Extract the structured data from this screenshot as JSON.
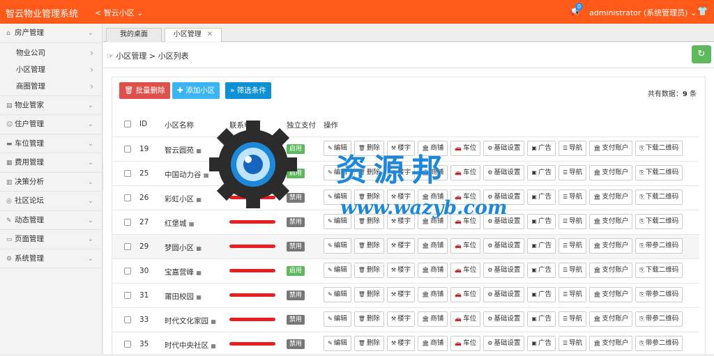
{
  "header": {
    "app_title": "智云物业管理系统",
    "community_selector": "智云小区",
    "notification_count": "0",
    "user": "administrator (系统管理员)"
  },
  "sidebar": {
    "items": [
      {
        "label": "房产管理",
        "icon": "home-icon"
      },
      {
        "label": "物业管家",
        "icon": "doc-icon"
      },
      {
        "label": "住户管理",
        "icon": "user-icon"
      },
      {
        "label": "车位管理",
        "icon": "car-icon"
      },
      {
        "label": "费用管理",
        "icon": "money-icon"
      },
      {
        "label": "决策分析",
        "icon": "chart-icon"
      },
      {
        "label": "社区论坛",
        "icon": "forum-icon"
      },
      {
        "label": "动态管理",
        "icon": "edit-icon"
      },
      {
        "label": "页面管理",
        "icon": "page-icon"
      },
      {
        "label": "系统管理",
        "icon": "gear-icon"
      }
    ],
    "subitems": [
      "物业公司",
      "小区管理",
      "商圈管理"
    ]
  },
  "tabs": [
    {
      "label": "我的桌面"
    },
    {
      "label": "小区管理"
    }
  ],
  "breadcrumb": {
    "root": "小区管理",
    "separator": ">",
    "current": "小区列表"
  },
  "toolbar": {
    "batch_delete": "批量删除",
    "add_community": "添加小区",
    "filter": "筛选条件",
    "total_prefix": "共有数据：",
    "total_count": "9",
    "total_suffix": " 条"
  },
  "table": {
    "headers": {
      "id": "ID",
      "name": "小区名称",
      "phone": "联系电话",
      "pay": "独立支付",
      "ops": "操作"
    },
    "rows": [
      {
        "id": "19",
        "name": "智云圆苑",
        "status": "启用"
      },
      {
        "id": "25",
        "name": "中国动力谷",
        "status": "启用"
      },
      {
        "id": "26",
        "name": "彩虹小区",
        "status": "禁用"
      },
      {
        "id": "27",
        "name": "红堡城",
        "status": "禁用"
      },
      {
        "id": "29",
        "name": "梦圆小区",
        "status": "禁用"
      },
      {
        "id": "30",
        "name": "宝嘉营峰",
        "status": "启用"
      },
      {
        "id": "31",
        "name": "莆田校园",
        "status": "禁用"
      },
      {
        "id": "33",
        "name": "时代文化家园",
        "status": "禁用"
      },
      {
        "id": "35",
        "name": "时代中央社区",
        "status": "禁用"
      }
    ],
    "ops": [
      "编辑",
      "删除",
      "楼宇",
      "商铺",
      "车位",
      "基础设置",
      "广告",
      "导航",
      "支付账户",
      "下载二维码"
    ],
    "ops_alt_last": "带参二维码"
  },
  "watermark": {
    "cn": "资源邦",
    "url": "www.wazyb.com"
  },
  "colors": {
    "topbar": "#ff5a1a",
    "danger": "#dd514c",
    "primary": "#3bb4f2",
    "secondary": "#0e90d2",
    "enabled": "#5eb95e",
    "disabled": "#777777"
  }
}
